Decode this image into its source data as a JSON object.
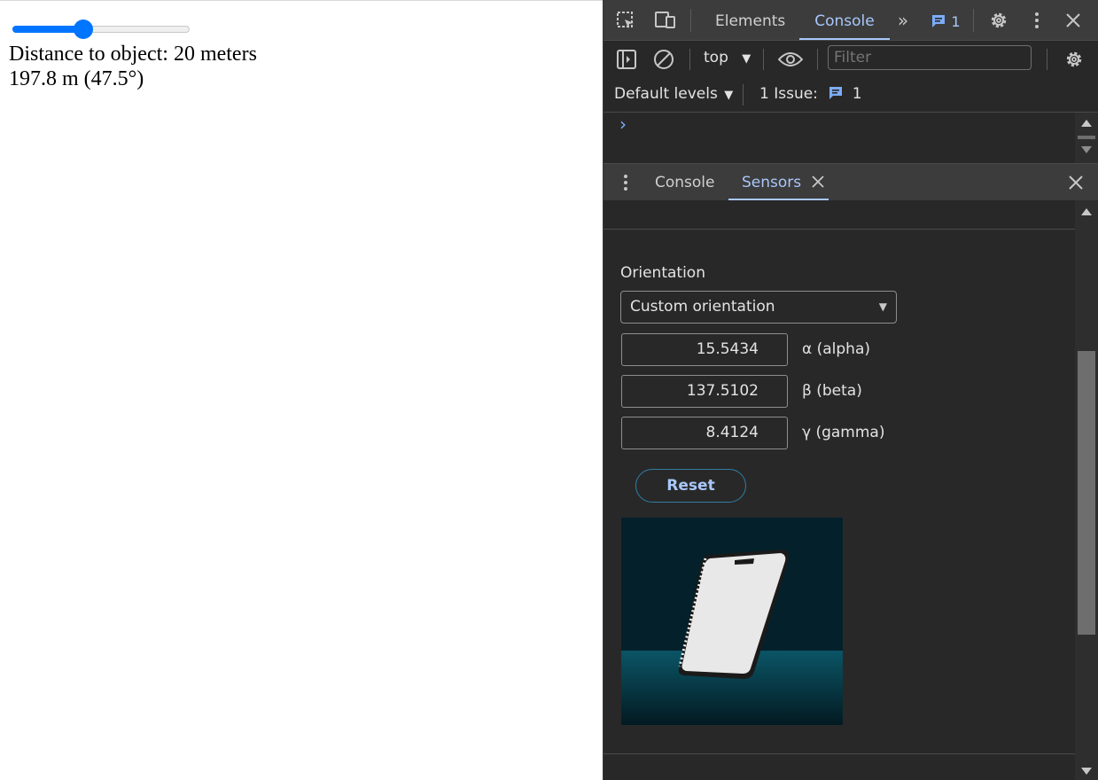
{
  "page": {
    "slider_fraction": 0.4,
    "distance_text": "Distance to object: 20 meters",
    "result_text": "197.8 m (47.5°)"
  },
  "devtools": {
    "tabs": [
      "Elements",
      "Console"
    ],
    "issues_badge": "1",
    "context": "top",
    "filter_placeholder": "Filter",
    "default_levels": "Default levels",
    "issue_label": "1 Issue:",
    "issue_count": "1",
    "console_prompt": "›",
    "drawer_tabs": [
      "Console",
      "Sensors"
    ],
    "orientation_label": "Orientation",
    "orientation_select": "Custom orientation",
    "alpha_value": "15.5434",
    "alpha_label": "α (alpha)",
    "beta_value": "137.5102",
    "beta_label": "β (beta)",
    "gamma_value": "8.4124",
    "gamma_label": "γ (gamma)",
    "reset_label": "Reset"
  },
  "colors": {
    "devtools_bg": "#282828",
    "toolbar_bg": "#3c3c3c",
    "accent": "#a8c7fa",
    "slider": "#0075ff"
  },
  "icons": [
    "inspect-element-icon",
    "device-toolbar-icon",
    "more-tabs-icon",
    "issues-icon",
    "settings-icon",
    "more-options-icon",
    "close-icon",
    "sidebar-toggle-icon",
    "clear-console-icon",
    "dropdown-arrow-icon",
    "eye-icon",
    "console-settings-icon",
    "drawer-menu-icon",
    "close-tab-icon",
    "close-drawer-icon",
    "scroll-up-icon",
    "scroll-down-icon",
    "select-arrow-icon"
  ]
}
